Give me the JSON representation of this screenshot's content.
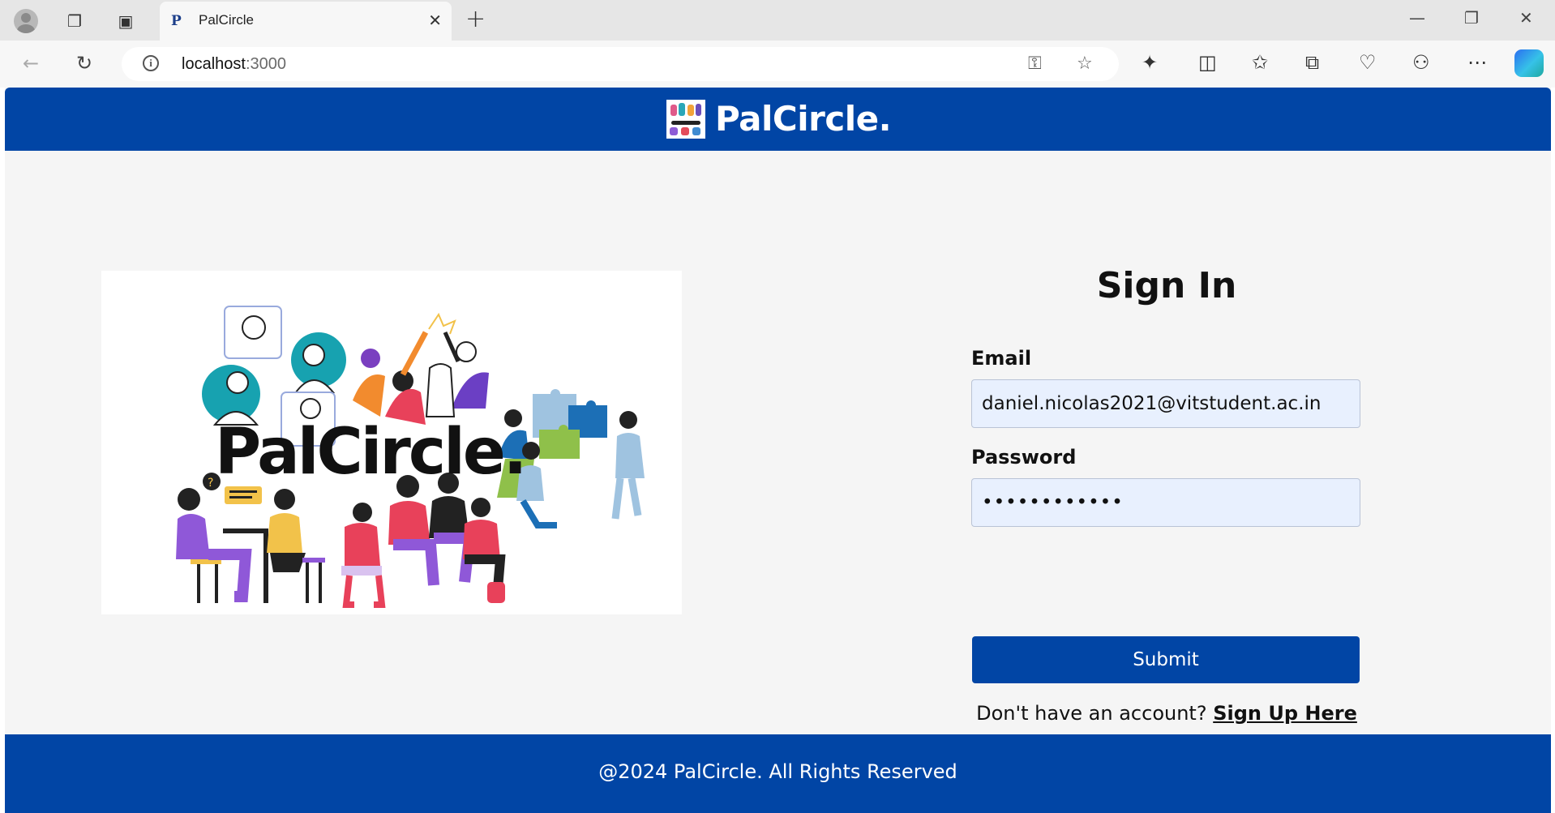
{
  "browser": {
    "tab_title": "PalCircle",
    "url_host": "localhost",
    "url_port": ":3000"
  },
  "header": {
    "brand_name": "PalCircle."
  },
  "hero": {
    "wordmark": "PalCircle."
  },
  "signin": {
    "title": "Sign In",
    "email_label": "Email",
    "email_value": "daniel.nicolas2021@vitstudent.ac.in",
    "password_label": "Password",
    "password_value": "••••••••••••",
    "submit_label": "Submit",
    "no_account_text": "Don't have an account?",
    "signup_link": "Sign Up Here"
  },
  "footer": {
    "text": "@2024 PalCircle. All Rights Reserved"
  },
  "colors": {
    "brand_blue": "#0145a5",
    "input_bg": "#e8f0fe",
    "page_bg": "#f5f5f5"
  }
}
